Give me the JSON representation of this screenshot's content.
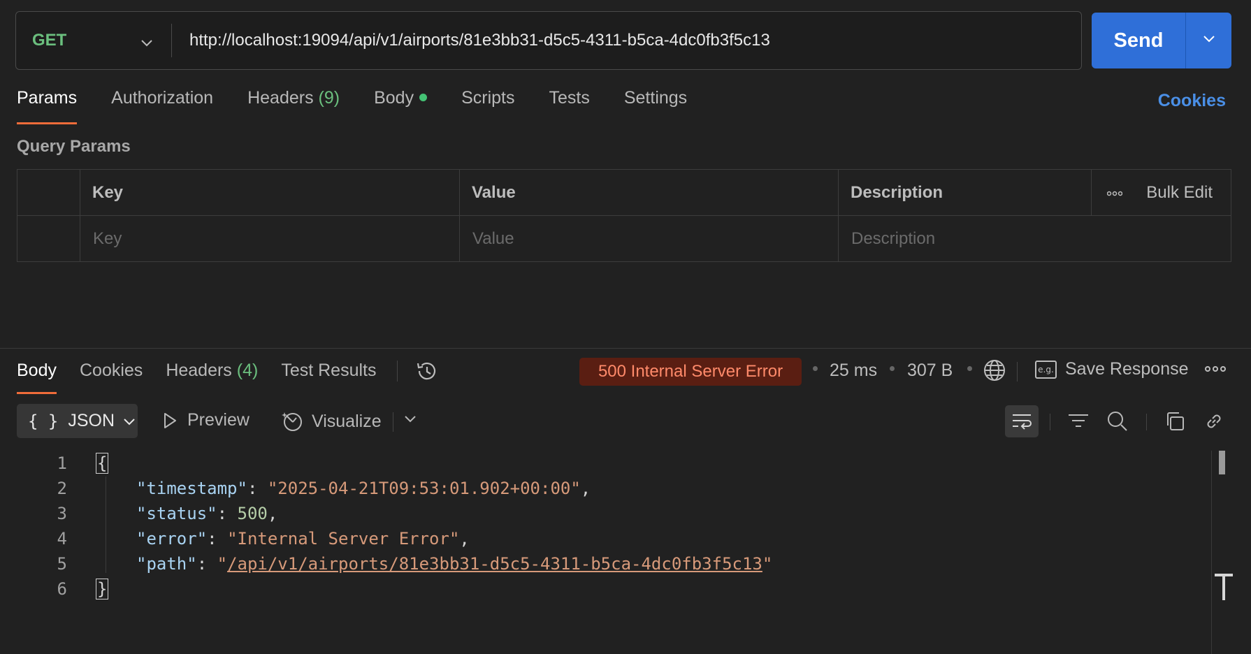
{
  "request": {
    "method": "GET",
    "url": "http://localhost:19094/api/v1/airports/81e3bb31-d5c5-4311-b5ca-4dc0fb3f5c13",
    "send_label": "Send"
  },
  "request_tabs": {
    "params": "Params",
    "authorization": "Authorization",
    "headers": "Headers",
    "headers_count": "(9)",
    "body": "Body",
    "scripts": "Scripts",
    "tests": "Tests",
    "settings": "Settings",
    "cookies": "Cookies"
  },
  "query_params": {
    "title": "Query Params",
    "columns": {
      "key": "Key",
      "value": "Value",
      "description": "Description"
    },
    "bulk_edit": "Bulk Edit",
    "placeholders": {
      "key": "Key",
      "value": "Value",
      "description": "Description"
    }
  },
  "response_tabs": {
    "body": "Body",
    "cookies": "Cookies",
    "headers": "Headers",
    "headers_count": "(4)",
    "test_results": "Test Results"
  },
  "response_meta": {
    "status": "500 Internal Server Error",
    "time": "25 ms",
    "size": "307 B",
    "save_response": "Save Response",
    "save_icon_text": "e.g."
  },
  "format_bar": {
    "format": "JSON",
    "preview": "Preview",
    "visualize": "Visualize"
  },
  "code": {
    "line_numbers": [
      "1",
      "2",
      "3",
      "4",
      "5",
      "6"
    ],
    "open_brace": "{",
    "close_brace": "}",
    "fields": [
      {
        "key": "\"timestamp\"",
        "value": "\"2025-04-21T09:53:01.902+00:00\"",
        "trail": ","
      },
      {
        "key": "\"status\"",
        "value": "500",
        "trail": ","
      },
      {
        "key": "\"error\"",
        "value": "\"Internal Server Error\"",
        "trail": ","
      },
      {
        "key": "\"path\"",
        "quote": "\"",
        "value": "/api/v1/airports/81e3bb31-d5c5-4311-b5ca-4dc0fb3f5c13",
        "trail": ""
      }
    ]
  },
  "colors": {
    "accent_blue": "#2f6fd8",
    "active_tab_underline": "#ef6c3a",
    "method_green": "#6bbf7e",
    "error_badge_bg": "#5a1e12",
    "error_badge_text": "#ff8a6a"
  },
  "icons": [
    "chevron-down-icon",
    "history-icon",
    "globe-icon",
    "example-icon",
    "more-icon",
    "braces-icon",
    "play-icon",
    "visualize-icon",
    "wrap-lines-icon",
    "filter-icon",
    "search-icon",
    "copy-icon",
    "link-icon"
  ]
}
